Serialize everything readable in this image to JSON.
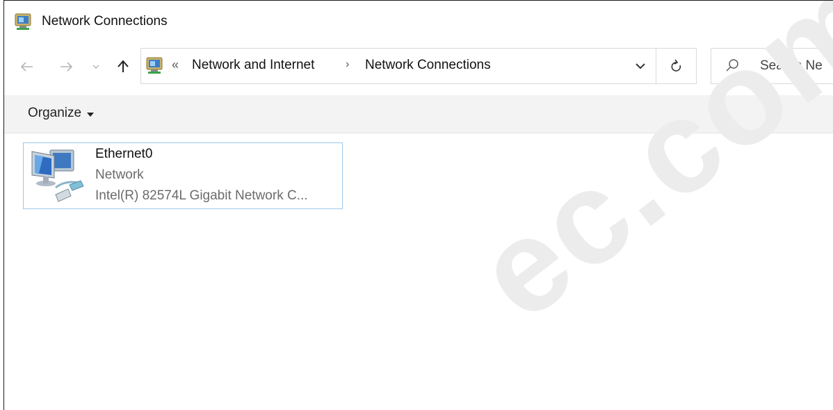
{
  "window": {
    "title": "Network Connections"
  },
  "nav": {
    "overflow_chevron": "«",
    "breadcrumbs": [
      {
        "label": "Network and Internet"
      },
      {
        "label": "Network Connections"
      }
    ],
    "separator": "›"
  },
  "search": {
    "placeholder": "Search Ne"
  },
  "commandbar": {
    "organize_label": "Organize"
  },
  "connections": [
    {
      "name": "Ethernet0",
      "status": "Network",
      "device": "Intel(R) 82574L Gigabit Network C..."
    }
  ],
  "watermark": {
    "text": "ec.com"
  },
  "icons": {
    "back": "arrow-left-icon",
    "forward": "arrow-right-icon",
    "recent": "chevron-down-icon",
    "up": "arrow-up-icon",
    "address_dropdown": "chevron-down-icon",
    "refresh": "refresh-icon",
    "search": "search-icon",
    "app": "network-connections-icon",
    "adapter": "ethernet-adapter-icon"
  }
}
